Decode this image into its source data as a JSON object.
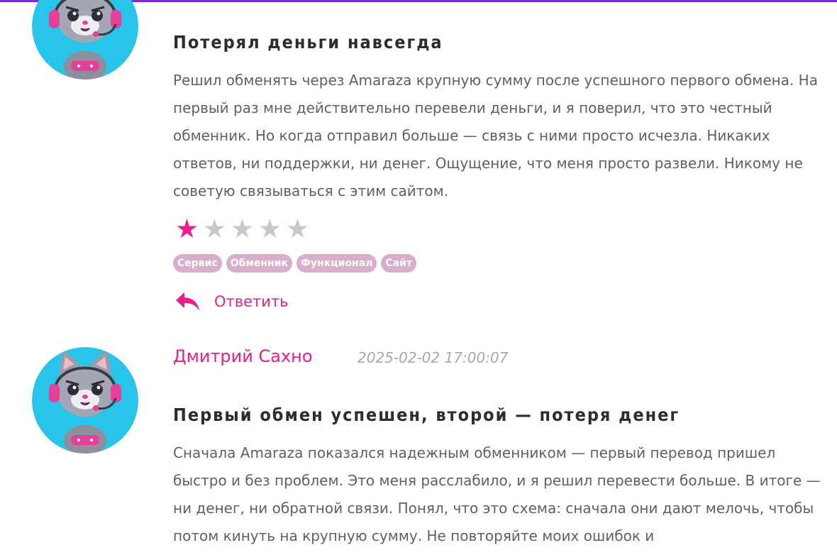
{
  "colors": {
    "accent": "#e91e8c",
    "top_bar": "#7b2bd6",
    "tag_bg": "#d9aecd",
    "avatar_bg": "#29c4ea",
    "star_off": "#c8c8cc"
  },
  "reviews": [
    {
      "avatar_icon": "gamer-cat-avatar-icon",
      "title": "Потерял деньги навсегда",
      "body": "Решил обменять через Amaraza крупную сумму после успешного первого обмена. На первый раз мне действительно перевели деньги, и я поверил, что это честный обменник. Но когда отправил больше — связь с ними просто исчезла. Никаких ответов, ни поддержки, ни денег. Ощущение, что меня просто развели. Никому не советую связываться с этим сайтом.",
      "rating": 1,
      "rating_max": 5,
      "tags": [
        "Сервис",
        "Обменник",
        "Функционал",
        "Сайт"
      ],
      "reply_label": "Ответить",
      "reply_icon": "reply-arrow-icon"
    },
    {
      "avatar_icon": "gamer-cat-avatar-icon",
      "author": "Дмитрий Сахно",
      "timestamp": "2025-02-02 17:00:07",
      "title": "Первый обмен успешен, второй — потеря денег",
      "body": "Сначала Amaraza показался надежным обменником — первый перевод пришел быстро и без проблем. Это меня расслабило, и я решил перевести больше. В итоге — ни денег, ни обратной связи. Понял, что это схема: сначала они дают мелочь, чтобы потом кинуть на крупную сумму. Не повторяйте моих ошибок и"
    }
  ]
}
